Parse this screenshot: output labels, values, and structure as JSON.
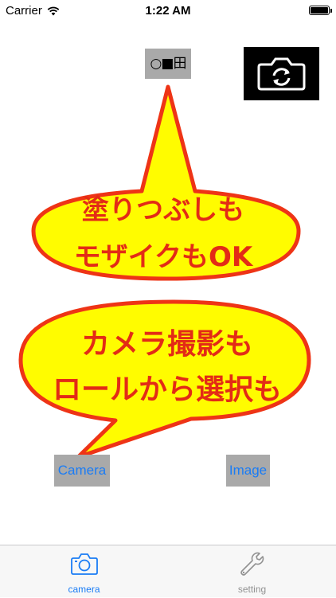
{
  "status_bar": {
    "carrier": "Carrier",
    "time": "1:22 AM",
    "battery_level": 1.0
  },
  "toolbar": {
    "mode_label": "○■田",
    "flip_icon": "camera-rotate-icon"
  },
  "bubbles": {
    "top": [
      "塗りつぶしも",
      "モザイクもOK"
    ],
    "bottom": [
      "カメラ撮影も",
      "ロールから選択も"
    ]
  },
  "actions": {
    "camera_label": "Camera",
    "image_label": "Image"
  },
  "tab_bar": {
    "tabs": [
      {
        "label": "camera",
        "icon": "camera-icon",
        "selected": true
      },
      {
        "label": "setting",
        "icon": "wrench-icon",
        "selected": false
      }
    ]
  },
  "colors": {
    "accent": "#1a7cf5",
    "bubble_fill": "#fffc00",
    "bubble_stroke": "#ee3416",
    "bubble_text": "#e32b16",
    "button_gray": "#a9a9a9"
  }
}
